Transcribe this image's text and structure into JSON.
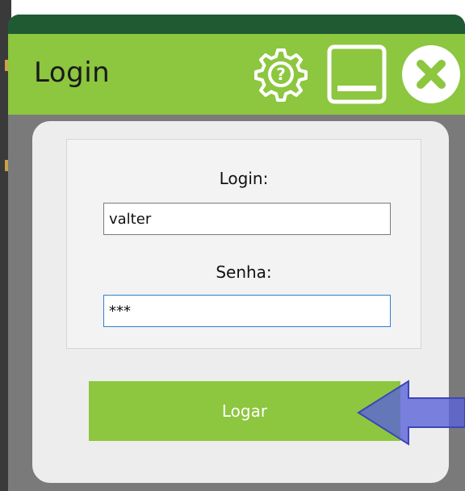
{
  "window": {
    "title": "Login",
    "accent_color": "#8dc63f",
    "top_strip_color": "#1f5a33"
  },
  "titlebar_buttons": {
    "help_icon": "gear-question-icon",
    "minimize_icon": "minimize-icon",
    "close_icon": "close-icon"
  },
  "form": {
    "login_label": "Login:",
    "login_value": "valter",
    "senha_label": "Senha:",
    "senha_value": "***"
  },
  "actions": {
    "submit_label": "Logar"
  },
  "annotation": {
    "arrow_icon": "left-arrow-icon",
    "arrow_color": "#5a63d8"
  }
}
